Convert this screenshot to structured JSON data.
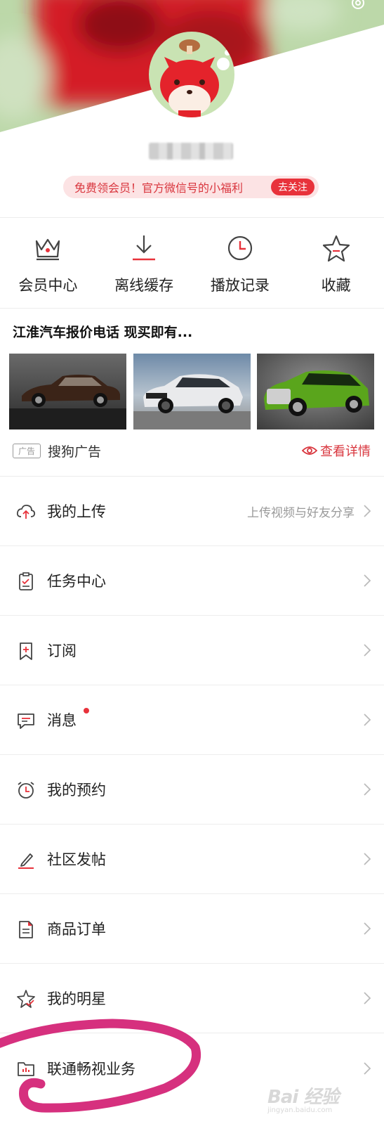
{
  "header": {
    "promo_text": "免费领会员！官方微信号的小福利",
    "promo_button": "去关注"
  },
  "quick_actions": [
    {
      "label": "会员中心",
      "icon": "crown-icon"
    },
    {
      "label": "离线缓存",
      "icon": "download-icon"
    },
    {
      "label": "播放记录",
      "icon": "history-clock-icon"
    },
    {
      "label": "收藏",
      "icon": "star-icon"
    }
  ],
  "ad": {
    "title": "江淮汽车报价电话 现买即有...",
    "tag": "广告",
    "source": "搜狗广告",
    "detail_link": "查看详情",
    "images": [
      "brown-sedan",
      "white-muscle-car",
      "green-sedan"
    ]
  },
  "menu": [
    {
      "label": "我的上传",
      "hint": "上传视频与好友分享",
      "icon": "cloud-upload-icon"
    },
    {
      "label": "任务中心",
      "hint": "",
      "icon": "clipboard-task-icon"
    },
    {
      "label": "订阅",
      "hint": "",
      "icon": "bookmark-add-icon"
    },
    {
      "label": "消息",
      "hint": "",
      "icon": "message-icon",
      "badge": true
    },
    {
      "label": "我的预约",
      "hint": "",
      "icon": "alarm-clock-icon"
    },
    {
      "label": "社区发帖",
      "hint": "",
      "icon": "pen-icon"
    },
    {
      "label": "商品订单",
      "hint": "",
      "icon": "order-document-icon"
    },
    {
      "label": "我的明星",
      "hint": "",
      "icon": "star-check-icon"
    },
    {
      "label": "联通畅视业务",
      "hint": "",
      "icon": "folder-chart-icon"
    }
  ],
  "watermark": {
    "text": "Bai 经验",
    "url": "jingyan.baidu.com"
  },
  "colors": {
    "accent": "#e8323b",
    "header_red": "#d8232c",
    "header_green": "#b8d8a8",
    "annotation_pink": "#d6307e"
  }
}
